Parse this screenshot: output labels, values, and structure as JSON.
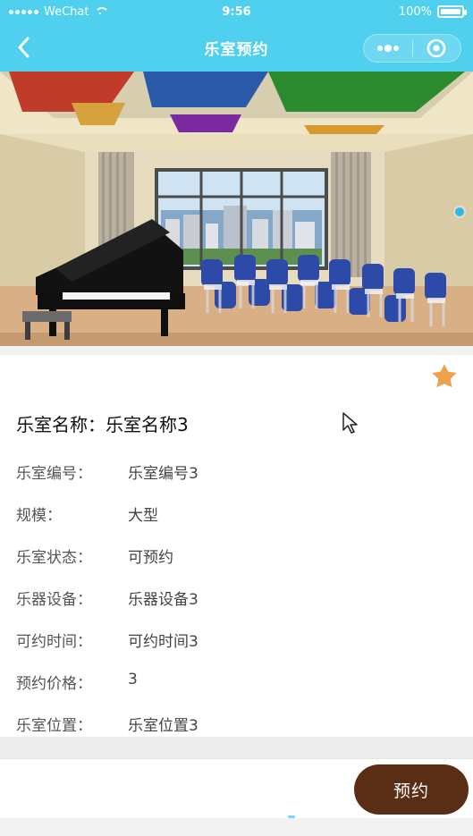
{
  "colors": {
    "accent": "#4fd0ee",
    "primary_button": "#5a2e14",
    "star": "#f0a24b"
  },
  "status_bar": {
    "carrier": "WeChat",
    "time": "9:56",
    "battery": "100%",
    "battery_level": 1.0
  },
  "nav": {
    "title": "乐室预约",
    "back_icon": "back-chevron-icon",
    "more_icon": "more-dots-icon",
    "close_icon": "target-close-icon"
  },
  "room": {
    "name_label": "乐室名称：",
    "name_value": "乐室名称3",
    "favorite_icon": "star-icon",
    "fields": [
      {
        "label": "乐室编号：",
        "value": "乐室编号3"
      },
      {
        "label": "规模：",
        "value": "大型"
      },
      {
        "label": "乐室状态：",
        "value": "可预约"
      },
      {
        "label": "乐器设备：",
        "value": "乐器设备3"
      },
      {
        "label": "可约时间：",
        "value": "可约时间3"
      },
      {
        "label": "预约价格：",
        "value": "3"
      },
      {
        "label": "乐室位置：",
        "value": "乐室位置3"
      }
    ]
  },
  "actions": {
    "reserve": "预约"
  }
}
